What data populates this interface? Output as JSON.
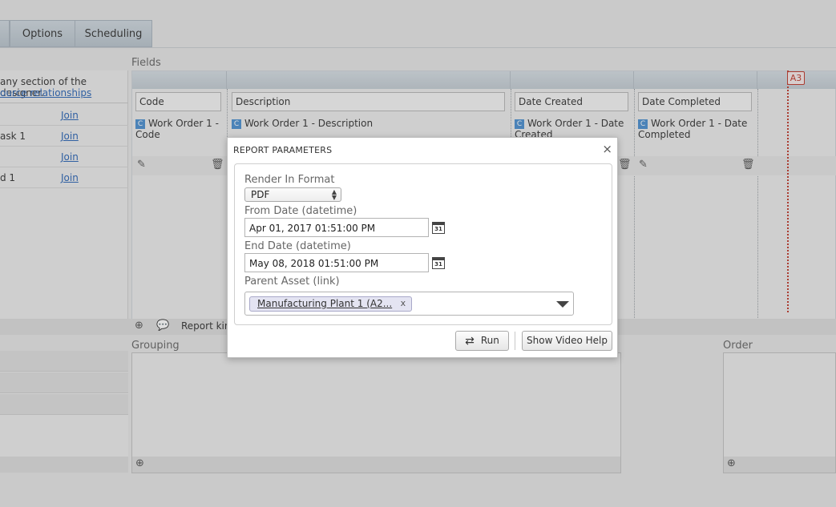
{
  "tabs": {
    "options": "Options",
    "scheduling": "Scheduling"
  },
  "left_panel": {
    "note": "any section of the designer.",
    "source_link": "ource relationships",
    "rows": [
      {
        "label": "",
        "join": "Join"
      },
      {
        "label": "ask 1",
        "join": "Join"
      },
      {
        "label": "",
        "join": "Join"
      },
      {
        "label": "d 1",
        "join": "Join"
      }
    ]
  },
  "fields": {
    "section_label": "Fields",
    "columns": [
      {
        "header": "Code",
        "value": "Work Order 1 - Code",
        "icon_letter": "C"
      },
      {
        "header": "Description",
        "value": "Work Order 1 - Description",
        "icon_letter": "C"
      },
      {
        "header": "Date Created",
        "value": "Work Order 1 - Date Created",
        "icon_letter": "C"
      },
      {
        "header": "Date Completed",
        "value": "Work Order 1 - Date Completed",
        "icon_letter": "C"
      }
    ],
    "page_marker": "A3",
    "report_kind_label": "Report kind"
  },
  "grouping": {
    "label": "Grouping"
  },
  "order": {
    "label": "Order"
  },
  "modal": {
    "title": "REPORT PARAMETERS",
    "close": "×",
    "render_label": "Render In Format",
    "render_value": "PDF",
    "from_label": "From Date (datetime)",
    "from_value": "Apr 01, 2017 01:51:00 PM",
    "end_label": "End Date (datetime)",
    "end_value": "May 08, 2018 01:51:00 PM",
    "calendar_text": "31",
    "asset_label": "Parent Asset (link)",
    "asset_chip": "Manufacturing Plant 1 (A2...",
    "chip_remove": "x",
    "run_label": "Run",
    "video_help_label": "Show Video Help"
  },
  "icons": {
    "calendar": "calendar-icon",
    "run": "refresh-icon",
    "edit": "edit-icon",
    "delete": "trash-icon",
    "add": "add-icon"
  }
}
